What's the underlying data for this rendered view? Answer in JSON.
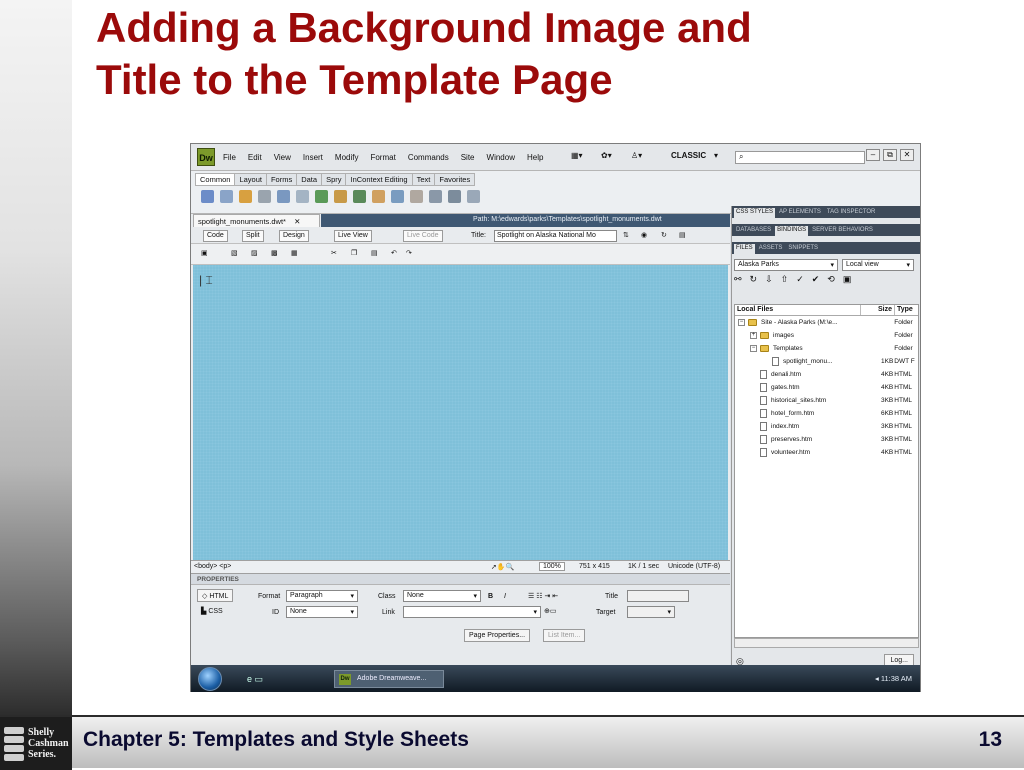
{
  "slide": {
    "title_line1": "Adding a Background Image and",
    "title_line2": "Title to the Template Page",
    "footer_chapter": "Chapter 5: Templates and Style Sheets",
    "page_number": "13",
    "logo_lines": [
      "Shelly",
      "Cashman",
      "Series."
    ]
  },
  "app": {
    "logo": "Dw",
    "menu": [
      "File",
      "Edit",
      "View",
      "Insert",
      "Modify",
      "Format",
      "Commands",
      "Site",
      "Window",
      "Help"
    ],
    "workspace": "CLASSIC",
    "window_controls": [
      "–",
      "⧉",
      "✕"
    ]
  },
  "insert_bar": {
    "tabs": [
      "Common",
      "Layout",
      "Forms",
      "Data",
      "Spry",
      "InContext Editing",
      "Text",
      "Favorites"
    ],
    "active_tab": "Common"
  },
  "document": {
    "tab_label": "spotlight_monuments.dwt*",
    "path_label": "Path:  M:\\edwards\\parks\\Templates\\spotlight_monuments.dwt",
    "views": {
      "code": "Code",
      "split": "Split",
      "design": "Design",
      "live_view": "Live View",
      "live_code": "Live Code"
    },
    "title_label": "Title:",
    "title_value": "Spotlight on Alaska National Mo"
  },
  "status": {
    "tags": "<body> <p>",
    "zoom": "100%",
    "size": "751 x 415",
    "download": "1K / 1 sec",
    "encoding": "Unicode (UTF-8)"
  },
  "properties": {
    "header": "PROPERTIES",
    "html_btn": "HTML",
    "css_btn": "CSS",
    "format_label": "Format",
    "format_value": "Paragraph",
    "class_label": "Class",
    "class_value": "None",
    "id_label": "ID",
    "id_value": "None",
    "link_label": "Link",
    "title_label": "Title",
    "target_label": "Target",
    "page_props_btn": "Page Properties...",
    "list_item_btn": "List Item..."
  },
  "panels": {
    "tabs_row1": [
      "CSS STYLES",
      "AP ELEMENTS",
      "TAG INSPECTOR"
    ],
    "tabs_row2": [
      "DATABASES",
      "BINDINGS",
      "SERVER BEHAVIORS"
    ],
    "tabs_row3": [
      "FILES",
      "ASSETS",
      "SNIPPETS"
    ],
    "site_select": "Alaska Parks",
    "view_select": "Local view",
    "columns": {
      "name": "Local Files",
      "size": "Size",
      "type": "Type"
    },
    "files": [
      {
        "name": "Site - Alaska Parks (M:\\e...",
        "size": "",
        "type": "Folder",
        "kind": "site"
      },
      {
        "name": "images",
        "size": "",
        "type": "Folder",
        "kind": "folder"
      },
      {
        "name": "Templates",
        "size": "",
        "type": "Folder",
        "kind": "folder"
      },
      {
        "name": "spotlight_monu...",
        "size": "1KB",
        "type": "DWT F",
        "kind": "page"
      },
      {
        "name": "denali.htm",
        "size": "4KB",
        "type": "HTML",
        "kind": "page"
      },
      {
        "name": "gates.htm",
        "size": "4KB",
        "type": "HTML",
        "kind": "page"
      },
      {
        "name": "historical_sites.htm",
        "size": "3KB",
        "type": "HTML",
        "kind": "page"
      },
      {
        "name": "hotel_form.htm",
        "size": "6KB",
        "type": "HTML",
        "kind": "page"
      },
      {
        "name": "index.htm",
        "size": "3KB",
        "type": "HTML",
        "kind": "page"
      },
      {
        "name": "preserves.htm",
        "size": "3KB",
        "type": "HTML",
        "kind": "page"
      },
      {
        "name": "volunteer.htm",
        "size": "4KB",
        "type": "HTML",
        "kind": "page"
      }
    ],
    "log_btn": "Log..."
  },
  "taskbar": {
    "task_label": "Adobe Dreamweave...",
    "clock": "11:38 AM"
  }
}
